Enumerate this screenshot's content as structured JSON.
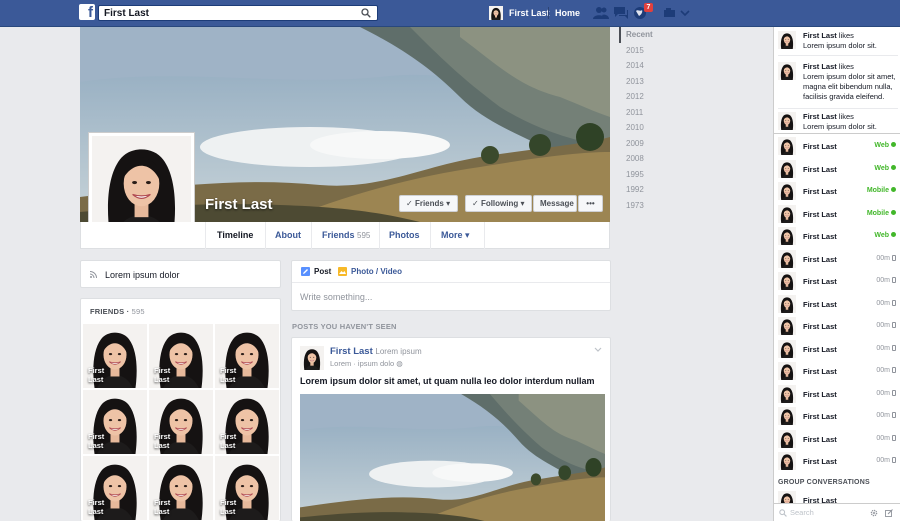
{
  "topbar": {
    "logo": "f",
    "search_value": "First Last",
    "user_name": "First Last",
    "home_label": "Home",
    "notification_count": "7"
  },
  "profile": {
    "name": "First Last",
    "buttons": {
      "friends": "Friends",
      "following": "Following",
      "message": "Message",
      "more": "•••"
    },
    "tabs": {
      "timeline": "Timeline",
      "about": "About",
      "friends": "Friends",
      "friends_count": "595",
      "photos": "Photos",
      "more": "More"
    }
  },
  "years": [
    "Recent",
    "2015",
    "2014",
    "2013",
    "2012",
    "2011",
    "2010",
    "2009",
    "2008",
    "1995",
    "1992",
    "1973"
  ],
  "about": {
    "text": "Lorem ipsum dolor"
  },
  "friends": {
    "title": "FRIENDS",
    "count": "595",
    "items": [
      {
        "name": "First\nLast"
      },
      {
        "name": "First\nLast"
      },
      {
        "name": "First\nLast"
      },
      {
        "name": "First\nLast"
      },
      {
        "name": "First\nLast"
      },
      {
        "name": "First\nLast"
      },
      {
        "name": "First\nLast"
      },
      {
        "name": "First\nLast"
      },
      {
        "name": "First\nLast"
      }
    ]
  },
  "composer": {
    "post_tab": "Post",
    "photo_tab": "Photo / Video",
    "placeholder": "Write something..."
  },
  "feed": {
    "section_title": "POSTS YOU HAVEN'T SEEN",
    "post": {
      "author": "First Last",
      "author_suffix": "Lorem ipsum",
      "meta": "Lorem · ipsum dolo",
      "text": "Lorem ipsum dolor sit amet, ut quam nulla leo dolor interdum nullam"
    }
  },
  "ticker": [
    {
      "name": "First Last",
      "action": "likes",
      "text": "Lorem ipsum dolor sit."
    },
    {
      "name": "First Last",
      "action": "likes",
      "text": "Lorem ipsum dolor sit amet, magna elit bibendum nulla, facilisis gravida eleifend."
    },
    {
      "name": "First Last",
      "action": "likes",
      "text": "Lorem ipsum dolor sit."
    }
  ],
  "chat": {
    "contacts": [
      {
        "name": "First Last",
        "status": "Web",
        "online": true
      },
      {
        "name": "First Last",
        "status": "Web",
        "online": true
      },
      {
        "name": "First Last",
        "status": "Mobile",
        "online": true
      },
      {
        "name": "First Last",
        "status": "Mobile",
        "online": true
      },
      {
        "name": "First Last",
        "status": "Web",
        "online": true
      },
      {
        "name": "First Last",
        "status": "00m",
        "online": false
      },
      {
        "name": "First Last",
        "status": "00m",
        "online": false
      },
      {
        "name": "First Last",
        "status": "00m",
        "online": false
      },
      {
        "name": "First Last",
        "status": "00m",
        "online": false
      },
      {
        "name": "First Last",
        "status": "00m",
        "online": false
      },
      {
        "name": "First Last",
        "status": "00m",
        "online": false
      },
      {
        "name": "First Last",
        "status": "00m",
        "online": false
      },
      {
        "name": "First Last",
        "status": "00m",
        "online": false
      },
      {
        "name": "First Last",
        "status": "00m",
        "online": false
      },
      {
        "name": "First Last",
        "status": "00m",
        "online": false
      }
    ],
    "group_title": "GROUP CONVERSATIONS",
    "group_contact": {
      "name": "First Last"
    },
    "search_placeholder": "Search"
  },
  "colors": {
    "brand": "#3b5998",
    "online": "#42b72a",
    "badge": "#e1403d"
  }
}
